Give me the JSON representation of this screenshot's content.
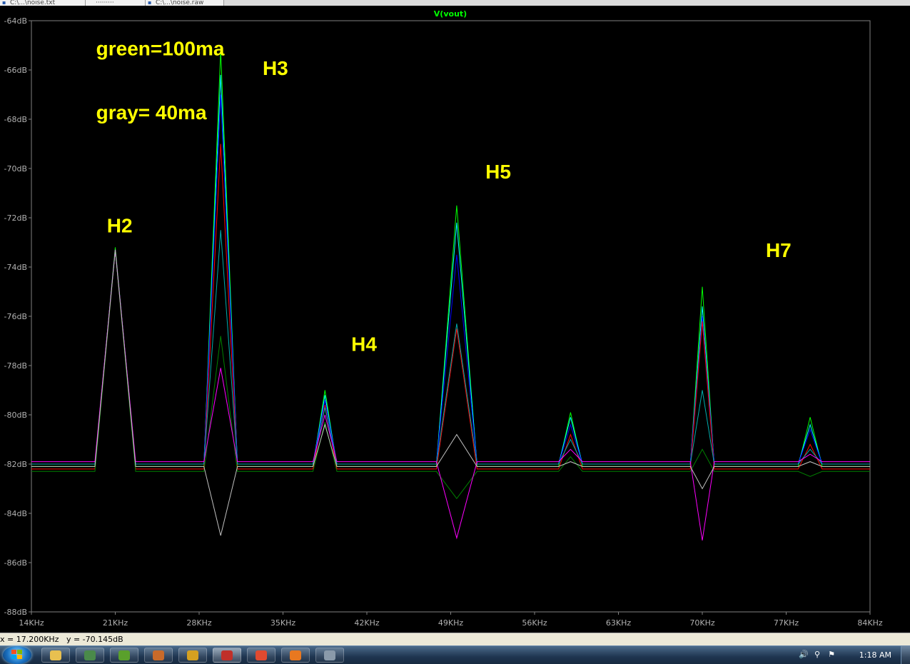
{
  "tabs": [
    {
      "label": "C:\\...\\noise.txt",
      "icon": "document-icon"
    },
    {
      "label": "·········",
      "icon": ""
    },
    {
      "label": "C:\\...\\noise.raw",
      "icon": "document-icon"
    }
  ],
  "chart_data": {
    "type": "line",
    "title": "V(vout)",
    "xlabel": "",
    "ylabel": "",
    "xlim": [
      14,
      84
    ],
    "ylim": [
      -88,
      -64
    ],
    "x_ticks": [
      14,
      21,
      28,
      35,
      42,
      49,
      56,
      63,
      70,
      77,
      84
    ],
    "x_tick_labels": [
      "14KHz",
      "21KHz",
      "28KHz",
      "35KHz",
      "42KHz",
      "49KHz",
      "56KHz",
      "63KHz",
      "70KHz",
      "77KHz",
      "84KHz"
    ],
    "y_ticks": [
      -64,
      -66,
      -68,
      -70,
      -72,
      -74,
      -76,
      -78,
      -80,
      -82,
      -84,
      -86,
      -88
    ],
    "y_tick_labels": [
      "-64dB",
      "-66dB",
      "-68dB",
      "-70dB",
      "-72dB",
      "-74dB",
      "-76dB",
      "-78dB",
      "-80dB",
      "-82dB",
      "-84dB",
      "-86dB",
      "-88dB"
    ],
    "grid": false,
    "background": "#000000",
    "title_color": "#00ff00",
    "axis_color": "#808080",
    "annotations": [
      {
        "text": "green=100ma",
        "x": 19.4,
        "y": -65.4
      },
      {
        "text": "gray= 40ma",
        "x": 19.4,
        "y": -68.0
      },
      {
        "text": "H2",
        "x": 20.3,
        "y": -72.6
      },
      {
        "text": "H3",
        "x": 33.3,
        "y": -66.2
      },
      {
        "text": "H4",
        "x": 40.7,
        "y": -77.4
      },
      {
        "text": "H5",
        "x": 51.9,
        "y": -70.4
      },
      {
        "text": "H7",
        "x": 75.3,
        "y": -73.6
      }
    ],
    "annotation_color": "#ffff00",
    "series": [
      {
        "color": "#00ff00",
        "base": -82.1,
        "peaks": [
          [
            21,
            -73.2
          ],
          [
            29.8,
            -65.2
          ],
          [
            38.5,
            -79.0
          ],
          [
            49.5,
            -71.5
          ],
          [
            59,
            -79.9
          ],
          [
            70,
            -74.8
          ],
          [
            79,
            -80.1
          ]
        ]
      },
      {
        "color": "#00ffff",
        "base": -82.0,
        "peaks": [
          [
            21,
            -73.3
          ],
          [
            29.8,
            -66.2
          ],
          [
            38.5,
            -79.2
          ],
          [
            49.5,
            -72.2
          ],
          [
            59,
            -80.1
          ],
          [
            70,
            -75.6
          ],
          [
            79,
            -80.4
          ]
        ]
      },
      {
        "color": "#0000ff",
        "base": -82.0,
        "peaks": [
          [
            21,
            -73.3
          ],
          [
            29.8,
            -67.0
          ],
          [
            38.5,
            -79.4
          ],
          [
            49.5,
            -73.5
          ],
          [
            59,
            -80.4
          ],
          [
            70,
            -76.0
          ],
          [
            79,
            -80.6
          ]
        ]
      },
      {
        "color": "#ff0000",
        "base": -82.2,
        "peaks": [
          [
            21,
            -73.3
          ],
          [
            29.8,
            -69.0
          ],
          [
            38.5,
            -79.6
          ],
          [
            49.5,
            -76.5
          ],
          [
            59,
            -80.8
          ],
          [
            70,
            -76.2
          ],
          [
            79,
            -81.2
          ]
        ]
      },
      {
        "color": "#00aaaa",
        "base": -82.0,
        "peaks": [
          [
            21,
            -73.3
          ],
          [
            29.8,
            -72.5
          ],
          [
            38.5,
            -79.7
          ],
          [
            49.5,
            -76.3
          ],
          [
            59,
            -81.0
          ],
          [
            70,
            -79.0
          ],
          [
            79,
            -81.4
          ]
        ]
      },
      {
        "color": "#008000",
        "base": -82.3,
        "peaks": [
          [
            21,
            -73.3
          ],
          [
            29.8,
            -76.8
          ],
          [
            38.5,
            -80.3
          ],
          [
            49.5,
            -83.4
          ],
          [
            59,
            -81.7
          ],
          [
            70,
            -81.4
          ],
          [
            79,
            -82.5
          ]
        ]
      },
      {
        "color": "#ff00ff",
        "base": -81.9,
        "peaks": [
          [
            21,
            -73.3
          ],
          [
            29.8,
            -78.1
          ],
          [
            38.5,
            -80.0
          ],
          [
            49.5,
            -85.0
          ],
          [
            59,
            -81.4
          ],
          [
            70,
            -85.1
          ],
          [
            79,
            -81.6
          ]
        ]
      },
      {
        "color": "#c0c0c0",
        "base": -82.1,
        "peaks": [
          [
            21,
            -73.3
          ],
          [
            29.8,
            -84.9
          ],
          [
            38.5,
            -80.4
          ],
          [
            49.5,
            -80.8
          ],
          [
            59,
            -81.9
          ],
          [
            70,
            -83.0
          ],
          [
            79,
            -81.9
          ]
        ]
      }
    ]
  },
  "statusbar": {
    "text": "x = 17.200KHz   y = -70.145dB"
  },
  "taskbar": {
    "clock": "1:18 AM",
    "apps": [
      {
        "name": "explorer-icon",
        "color": "#e8c050"
      },
      {
        "name": "monitor-icon",
        "color": "#4a8a4a"
      },
      {
        "name": "utorrent-icon",
        "color": "#5aa02c"
      },
      {
        "name": "character-icon",
        "color": "#c86a2a"
      },
      {
        "name": "tools-icon",
        "color": "#d4a020"
      },
      {
        "name": "ltspice-icon",
        "color": "#c0302a"
      },
      {
        "name": "chrome-icon",
        "color": "#e04a30"
      },
      {
        "name": "app-orange-icon",
        "color": "#e87820"
      },
      {
        "name": "device-icon",
        "color": "#8a9aaa"
      }
    ]
  }
}
